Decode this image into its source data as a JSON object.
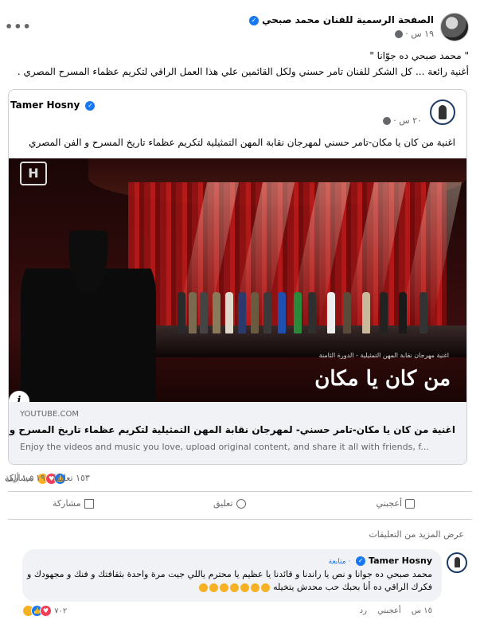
{
  "post": {
    "author": "الصفحة الرسمية للفنان محمد صبحي",
    "time": "١٩ س ·",
    "text_line1": "\" محمد صبحي ده جوّانا \"",
    "text_line2": "أغنية رائعة ... كل الشكر للفنان تامر حسني ولكل القائمين علي هذا العمل الراقي لتكريم عظماء المسرح المصري ."
  },
  "shared": {
    "author": "Tamer Hosny",
    "time": "٢٠ س ·",
    "text": "اغنية من كان يا مكان-تامر حسني لمهرجان نقابة المهن التمثيلية لتكريم عظماء تاريخ المسرح و الفن المصري",
    "media": {
      "logo": "H",
      "title": "من كان يا مكان",
      "subtitle": "اغنية مهرجان نقابة المهن التمثيلية - الدورة الثامنة"
    },
    "link": {
      "domain": "YOUTUBE.COM",
      "title": "اغنية من كان يا مكان-تامر حسني- لمهرجان نقابة المهن التمثيلية لتكريم عظماء تاريخ المسرح و الفن المصري",
      "description": "Enjoy the videos and music you love, upload original content, and share it all with friends, f..."
    }
  },
  "stats": {
    "reactions_count": "١٫٥ ألف",
    "comments": "١٥٣ تعليقًا",
    "shares": "١٩ مشاركة"
  },
  "actions": {
    "like": "أعجبني",
    "comment": "تعليق",
    "share": "مشاركة"
  },
  "comments": {
    "more_label": "عرض المزيد من التعليقات",
    "items": [
      {
        "author": "Tamer Hosny",
        "follow": "· متابعة",
        "text": "محمد صبحي ده جوانا و نص يا راندنا و قائدنا يا عظيم يا محترم ياللي جيت مرة واحدة بثقافتك و فنك و مجهودك و فكرك الراقي ده أنا بحبك حب محدش يتخيله",
        "time": "١٥ س",
        "like": "أعجبني",
        "reply": "رد",
        "reactions": "٧٠٢"
      }
    ]
  },
  "colors": {
    "brand_blue": "#1877f2",
    "secondary_text": "#65676b",
    "bubble_bg": "#f0f2f5"
  }
}
